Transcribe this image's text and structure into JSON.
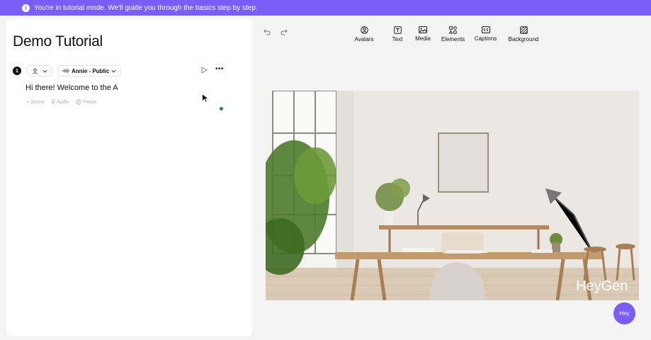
{
  "banner": {
    "text": "You're in tutorial mode. We'll guide you through the basics step by step."
  },
  "editor": {
    "title": "Demo Tutorial",
    "scene": {
      "number": "1",
      "voice": "Annie - Public",
      "script": "Hi there! Welcome to the A"
    },
    "add_buttons": [
      {
        "label": "Scene",
        "icon": "plus-icon"
      },
      {
        "label": "Audio",
        "icon": "microphone-icon"
      },
      {
        "label": "Pause",
        "icon": "pause-icon"
      }
    ]
  },
  "toolbar": {
    "items": [
      {
        "label": "Avatars",
        "icon": "avatar-icon"
      },
      {
        "label": "Text",
        "icon": "text-icon"
      },
      {
        "label": "Media",
        "icon": "image-icon"
      },
      {
        "label": "Elements",
        "icon": "elements-icon"
      },
      {
        "label": "Captions",
        "icon": "captions-icon"
      },
      {
        "label": "Background",
        "icon": "background-icon"
      }
    ]
  },
  "canvas": {
    "watermark": "HeyGen"
  },
  "help": {
    "label": "Hey"
  },
  "colors": {
    "accent": "#7b5cf6",
    "brand": "#7b5cf6"
  }
}
